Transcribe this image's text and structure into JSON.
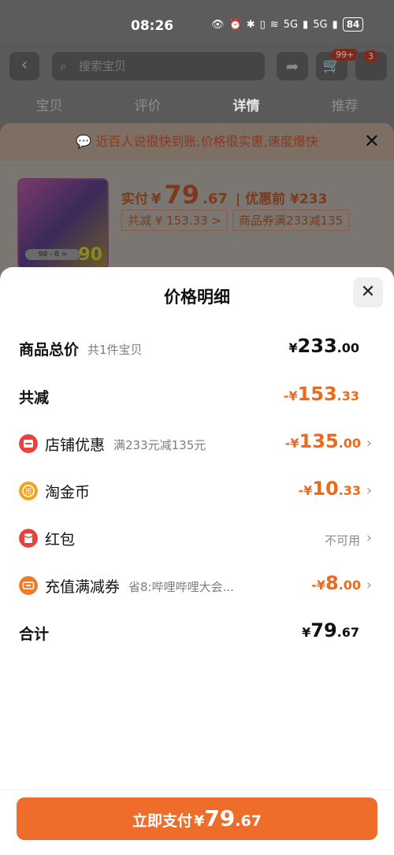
{
  "status": {
    "time": "08:26",
    "battery": "84",
    "signal1": "5G",
    "signal2": "5G"
  },
  "nav": {
    "search_placeholder": "搜索宝贝",
    "cart_badge": "99+",
    "msg_badge": "3",
    "tabs": [
      "宝贝",
      "评价",
      "详情",
      "推荐"
    ]
  },
  "promo": {
    "banner": "近百人说很快到账,价格很实惠,速度爆快",
    "pay_label": "实付",
    "price_currency": "¥",
    "price_int": "79",
    "price_dec": ".67",
    "before_label": "| 优惠前 ¥233",
    "chip_total": "共减 ¥ 153.33 >",
    "chip_coupon": "商品券满233减135",
    "thumb_number": "90",
    "thumb_code": "98 - 8 ="
  },
  "sheet": {
    "title": "价格明细",
    "rows": {
      "total": {
        "label": "商品总价",
        "sub": "共1件宝贝",
        "cur": "¥",
        "int": "233",
        "dec": ".00"
      },
      "reduce": {
        "label": "共减",
        "cur": "-¥",
        "int": "153",
        "dec": ".33"
      },
      "shop": {
        "label": "店铺优惠",
        "sub": "满233元减135元",
        "cur": "-¥",
        "int": "135",
        "dec": ".00"
      },
      "coin": {
        "label": "淘金币",
        "cur": "-¥",
        "int": "10",
        "dec": ".33"
      },
      "redpack": {
        "label": "红包",
        "status": "不可用"
      },
      "recharge": {
        "label": "充值满减券",
        "sub": "省8:哔哩哔哩大会...",
        "cur": "-¥",
        "int": "8",
        "dec": ".00"
      },
      "sum": {
        "label": "合计",
        "cur": "¥",
        "int": "79",
        "dec": ".67"
      }
    },
    "pay_button": {
      "label": "立即支付",
      "cur": "¥",
      "int": "79",
      "dec": ".67"
    }
  },
  "colors": {
    "accent": "#ee6d2b",
    "discount": "#ee6a1a",
    "shop_icon": "#e8423a",
    "coin_icon": "#f3a21b",
    "redpack_icon": "#e8423a",
    "recharge_icon": "#ef7a2a"
  }
}
